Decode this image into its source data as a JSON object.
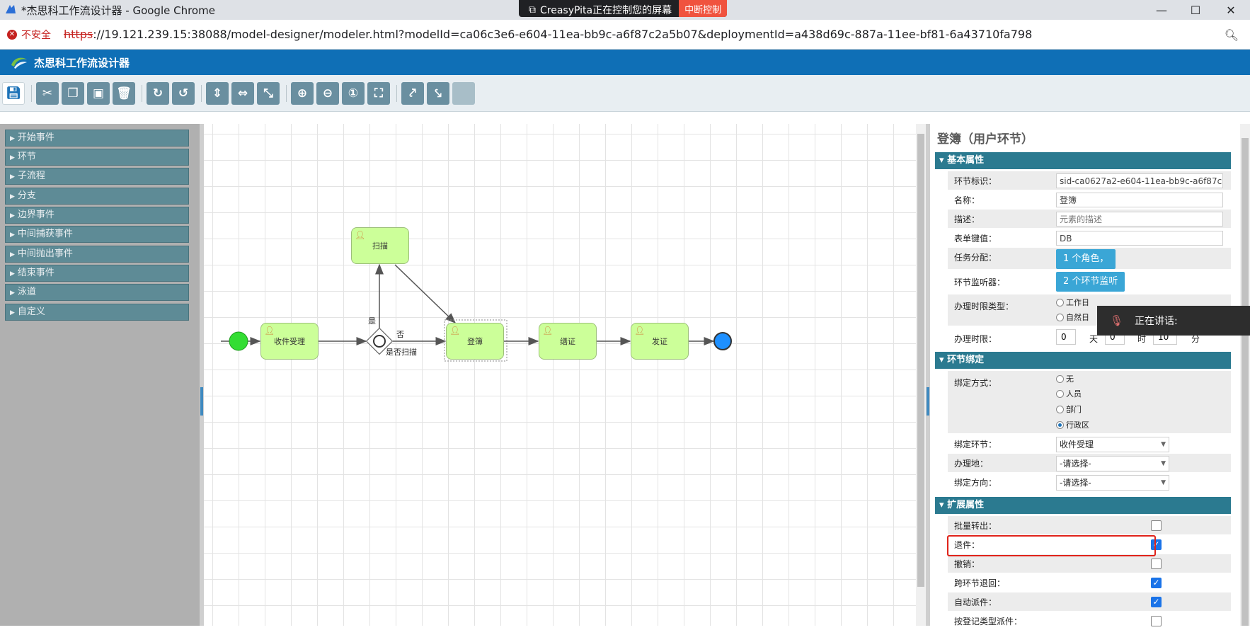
{
  "browser": {
    "window_title": "*杰思科工作流设计器 - Google Chrome",
    "screen_share_msg": "CreasyPita正在控制您的屏幕",
    "screen_share_stop": "中断控制",
    "security_label": "不安全",
    "url_scheme": "https",
    "url_rest": "://19.121.239.15:38088/model-designer/modeler.html?modelId=ca06c3e6-e604-11ea-bb9c-a6f87c2a5b07&deploymentId=a438d69c-887a-11ee-bf81-6a43710fa798",
    "minimize": "—",
    "maximize": "☐",
    "close": "✕"
  },
  "app": {
    "title": "杰思科工作流设计器"
  },
  "palette": {
    "items": [
      "开始事件",
      "环节",
      "子流程",
      "分支",
      "边界事件",
      "中间捕获事件",
      "中间抛出事件",
      "结束事件",
      "泳道",
      "自定义"
    ]
  },
  "diagram": {
    "tasks": [
      "收件受理",
      "扫描",
      "登簿",
      "缮证",
      "发证"
    ],
    "edge_labels": {
      "yes": "是",
      "no": "否",
      "gateway": "是否扫描"
    }
  },
  "props": {
    "title": "登簿（用户环节）",
    "basic": {
      "section": "基本属性",
      "id_label": "环节标识：",
      "id_value": "sid-ca0627a2-e604-11ea-bb9c-a6f87c2a5",
      "name_label": "名称：",
      "name_value": "登簿",
      "desc_label": "描述：",
      "desc_placeholder": "元素的描述",
      "formkey_label": "表单键值：",
      "formkey_value": "DB",
      "assign_label": "任务分配：",
      "assign_value": "1 个角色，",
      "listener_label": "环节监听器：",
      "listener_value": "2 个环节监听",
      "timetype_label": "办理时限类型：",
      "timetype_options": [
        "工作日",
        "自然日"
      ],
      "timelimit_label": "办理时限：",
      "timelimit_values": [
        "0",
        "0",
        "10"
      ],
      "timelimit_units": [
        "天",
        "时",
        "分"
      ]
    },
    "binding": {
      "section": "环节绑定",
      "mode_label": "绑定方式：",
      "mode_options": [
        "无",
        "人员",
        "部门",
        "行政区"
      ],
      "mode_selected": "行政区",
      "node_label": "绑定环节：",
      "node_value": "收件受理",
      "place_label": "办理地：",
      "place_value": "-请选择-",
      "dir_label": "绑定方向：",
      "dir_value": "-请选择-"
    },
    "extended": {
      "section": "扩展属性",
      "items": [
        {
          "label": "批量转出：",
          "checked": false
        },
        {
          "label": "退件：",
          "checked": true
        },
        {
          "label": "撤销：",
          "checked": false
        },
        {
          "label": "跨环节退回：",
          "checked": true
        },
        {
          "label": "自动派件：",
          "checked": true
        },
        {
          "label": "按登记类型派件：",
          "checked": false
        }
      ]
    }
  },
  "toast": {
    "text": "正在讲话:"
  }
}
